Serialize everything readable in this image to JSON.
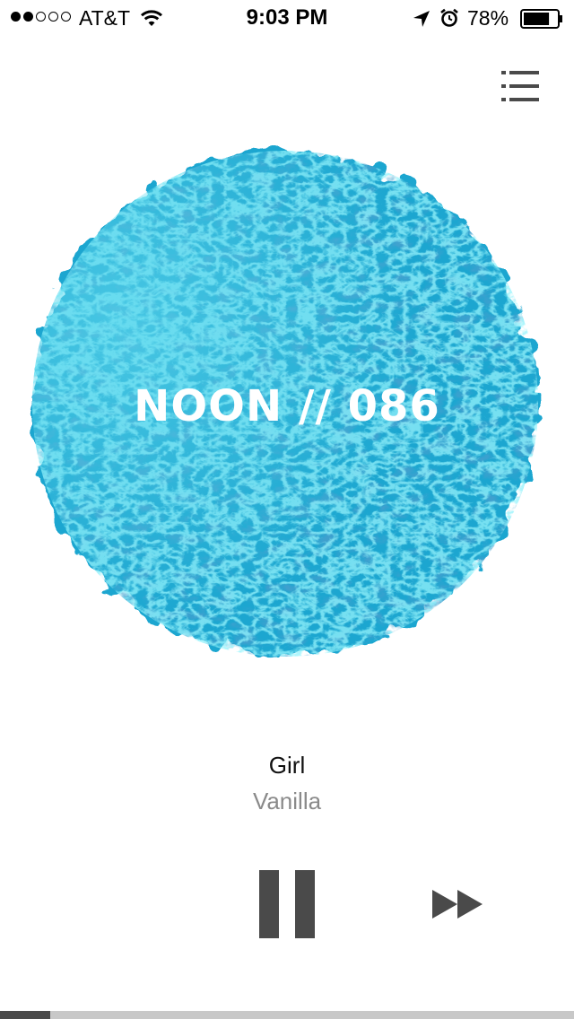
{
  "status_bar": {
    "signal_bars_filled": 2,
    "signal_bars_total": 5,
    "carrier": "AT&T",
    "time": "9:03 PM",
    "battery_percent_label": "78%",
    "battery_level": 0.78,
    "icons": [
      "wifi-icon",
      "location-arrow-icon",
      "alarm-clock-icon",
      "battery-icon"
    ]
  },
  "header": {
    "menu_icon": "list-menu-icon"
  },
  "artwork": {
    "title": "NOON // 086",
    "colors": {
      "base": "#1aa6d0",
      "light": "#3fd6ef",
      "dark": "#0a4f8a"
    }
  },
  "track": {
    "title": "Girl",
    "artist": "Vanilla"
  },
  "controls": {
    "pause_icon": "pause-icon",
    "skip_icon": "fast-forward-icon",
    "icon_color": "#4a4a4a"
  },
  "progress": {
    "fraction": 0.087,
    "track_color": "#c8c8c8",
    "fill_color": "#4a4a4a"
  }
}
